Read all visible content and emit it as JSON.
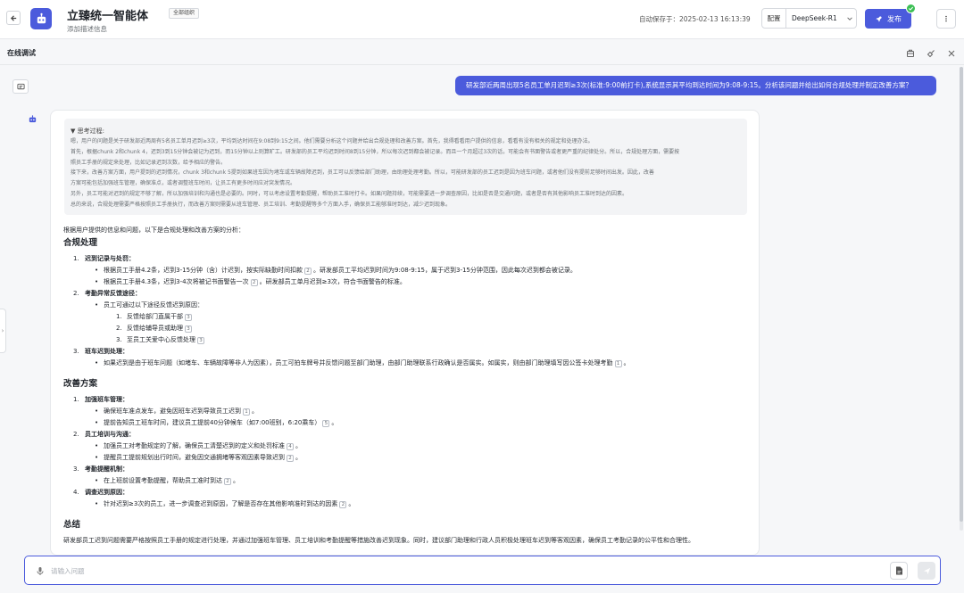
{
  "header": {
    "title": "立臻统一智能体",
    "scope_badge": "全部组织",
    "description": "添加描述信息",
    "autosave_text": "自动保存于：2025-02-13 16:13:39",
    "config_label": "配置",
    "model": "DeepSeek-R1",
    "publish_label": "发布"
  },
  "debug": {
    "title": "在线调试"
  },
  "conversation": {
    "user_message": "研发部近两周出现5名员工单月迟到≥3次(标准:9:00前打卡),系统显示其平均到达时间为9:08-9:15。分析该问题并给出如何合规处理并制定改善方案？",
    "thinking": {
      "title": "▼ 思考过程:",
      "lines": [
        "嗯，用户的问题是关于研发部近两周有5名员工单月迟到≥3次，平均到达时间在9:08到9:15之间。他们需要分析这个问题并给出合规处理和改善方案。首先，我得看看用户提供的信息，看看有没有相关的规定和处理办法。",
        "首先，根据chunk 2和chunk 4，迟到3到15分钟会被记为迟到，而15分钟以上则算旷工。研发部的员工平均迟到时间8到15分钟，所以每次迟到都会被记录。而且一个月超过3次的话，可能会有书面警告或者更严重的纪律处分。所以，合规处理方面，需要按",
        "照员工手册的规定来处理，比如记录迟到次数，给予相应的警告。",
        "接下来，改善方案方面，用户提到的迟到情况，chunk 3和chunk 5提到如果班车因为堵车或车辆故障迟到，员工可以反馈给部门助理，由助理处理考勤。所以，可能研发部的员工迟到是因为班车问题，或者他们没有提前足够时间出发。因此，改善",
        "方案可能包括加强班车管理，确保准点，或者调整班车时间，让员工有更多时间应对突发情况。",
        "另外，员工可能对迟到的规定不够了解，所以加强培训和沟通也是必要的。同时，可以考虑设置考勤提醒，帮助员工准时打卡。如果问题持续，可能需要进一步调查原因，比如是否是交通问题，或者是否有其他影响员工准时到达的因素。",
        "总的来说，合规处理需要严格按照员工手册执行，而改善方案则需要从班车管理、员工培训、考勤提醒等多个方面入手，确保员工能够准时到达，减少迟到现象。"
      ]
    },
    "answer": {
      "intro": "根据用户提供的信息和问题，以下是合规处理和改善方案的分析：",
      "section1_title": "合规处理",
      "s1_i1_title": "迟到记录与处罚：",
      "s1_i1_b1": "根据员工手册4.2条，迟到3-15分钟（含）计迟到，按实际缺勤时间扣款",
      "s1_i1_b1_ref": "2",
      "s1_i1_b1_tail": "。研发部员工平均迟到时间为9:08-9:15，属于迟到3-15分钟范围，因此每次迟到都会被记录。",
      "s1_i1_b2": "根据员工手册4.3条，迟到3-4次将被记书面警告一次",
      "s1_i1_b2_ref": "2",
      "s1_i1_b2_tail": "。研发部员工单月迟到≥3次，符合书面警告的标准。",
      "s1_i2_title": "考勤异常反馈途径：",
      "s1_i2_b1": "员工可通过以下途径反馈迟到原因：",
      "s1_i2_n1": "反馈给部门直属干部",
      "s1_i2_n1_ref": "3",
      "s1_i2_n2": "反馈给辅导员或助理",
      "s1_i2_n2_ref": "3",
      "s1_i2_n3": "至员工关爱中心反馈处理",
      "s1_i2_n3_ref": "3",
      "s1_i3_title": "班车迟到处理：",
      "s1_i3_b1": "如果迟到是由于班车问题（如堵车、车辆故障等非人为因素），员工可拍车牌号并反馈问题至部门助理，由部门助理联系行政确认是否属实。如属实，则由部门助理填写因公签卡处理考勤",
      "s1_i3_b1_ref": "1",
      "s1_i3_b1_tail": "。",
      "section2_title": "改善方案",
      "s2_i1_title": "加强班车管理：",
      "s2_i1_b1": "确保班车准点发车，避免因班车迟到导致员工迟到",
      "s2_i1_b1_ref": "1",
      "s2_i1_b1_tail": "。",
      "s2_i1_b2": "提前告知员工班车时间，建议员工提前40分钟候车（如7:00班别，6:20乘车）",
      "s2_i1_b2_ref": "5",
      "s2_i1_b2_tail": "。",
      "s2_i2_title": "员工培训与沟通：",
      "s2_i2_b1": "加强员工对考勤规定的了解，确保员工清楚迟到的定义和处罚标准",
      "s2_i2_b1_ref": "4",
      "s2_i2_b1_tail": "。",
      "s2_i2_b2": "提醒员工提前规划出行时间，避免因交通拥堵等客观因素导致迟到",
      "s2_i2_b2_ref": "2",
      "s2_i2_b2_tail": "。",
      "s2_i3_title": "考勤提醒机制：",
      "s2_i3_b1": "在上班前设置考勤提醒，帮助员工准时到达",
      "s2_i3_b1_ref": "2",
      "s2_i3_b1_tail": "。",
      "s2_i4_title": "调查迟到原因：",
      "s2_i4_b1": "针对迟到≥3次的员工，进一步调查迟到原因，了解是否存在其他影响准时到达的因素",
      "s2_i4_b1_ref": "2",
      "s2_i4_b1_tail": "。",
      "section3_title": "总结",
      "summary": "研发部员工迟到问题需要严格按照员工手册的规定进行处理，并通过加强班车管理、员工培训和考勤提醒等措施改善迟到现象。同时，建议部门助理和行政人员积极处理班车迟到等客观因素，确保员工考勤记录的公平性和合理性。"
    }
  },
  "input": {
    "placeholder": "请输入问题",
    "value": ""
  },
  "colors": {
    "accent": "#4b5bdc",
    "success": "#3cbf55"
  },
  "icons": [
    "back-arrow-icon",
    "robot-icon",
    "chevron-down-icon",
    "rocket-icon",
    "check-icon",
    "more-vertical-icon",
    "panel-icon",
    "clean-icon",
    "close-icon",
    "chat-history-icon",
    "microphone-icon",
    "document-icon",
    "send-icon"
  ]
}
